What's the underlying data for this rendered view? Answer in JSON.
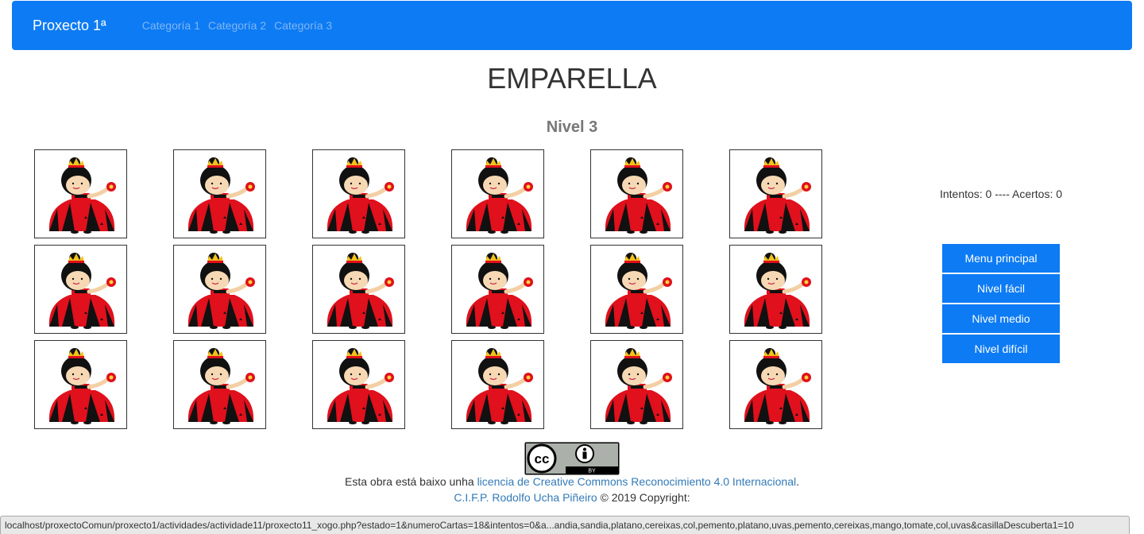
{
  "navbar": {
    "brand": "Proxecto 1ª",
    "links": [
      "Categoría 1",
      "Categoría 2",
      "Categoría 3"
    ]
  },
  "page": {
    "title": "EMPARELLA",
    "level": "Nivel 3"
  },
  "game": {
    "cards": [
      "card-back",
      "card-back",
      "card-back",
      "card-back",
      "card-back",
      "card-back",
      "card-back",
      "card-back",
      "card-back",
      "card-back",
      "card-back",
      "card-back",
      "card-back",
      "card-back",
      "card-back",
      "card-back",
      "card-back",
      "card-back"
    ],
    "score": "Intentos: 0 ---- Acertos: 0"
  },
  "menu": {
    "items": [
      "Menu principal",
      "Nivel fácil",
      "Nivel medio",
      "Nivel difícil"
    ]
  },
  "footer": {
    "badge_cc": "cc",
    "badge_by": "BY",
    "license_prefix": "Esta obra está baixo unha ",
    "license_link": "licencia de Creative Commons Reconocimiento 4.0 Internacional",
    "license_suffix": ".",
    "credit_link": "C.I.F.P. Rodolfo Ucha Piñeiro",
    "credit_suffix": " © 2019 Copyright:"
  },
  "statusbar": {
    "url": "localhost/proxectoComun/proxecto1/actividades/actividade11/proxecto11_xogo.php?estado=1&numeroCartas=18&intentos=0&a...andia,sandia,platano,cereixas,col,pemento,platano,uvas,pemento,cereixas,mango,tomate,col,uvas&casillaDescuberta1=10"
  },
  "colors": {
    "navbar": "#0d7bf4",
    "button": "#0d7bf4",
    "link": "#337ab7",
    "card_dress_red": "#e0101c",
    "card_dress_black": "#111111"
  }
}
